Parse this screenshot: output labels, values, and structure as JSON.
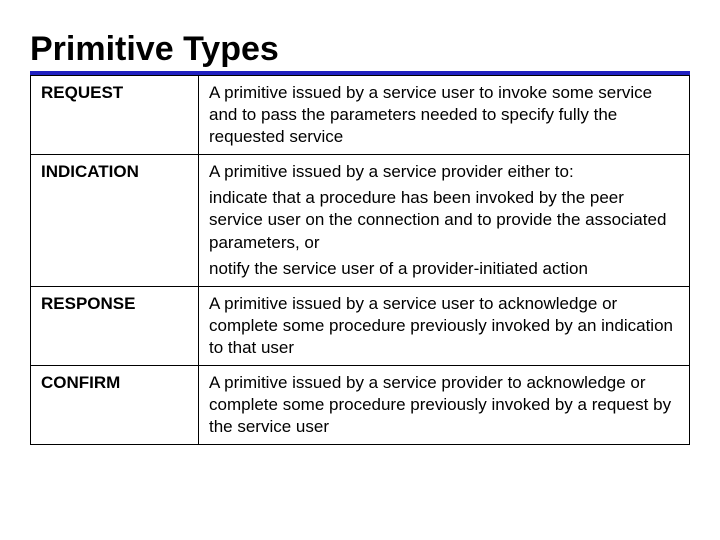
{
  "title": "Primitive Types",
  "rows": [
    {
      "name": "REQUEST",
      "desc": [
        "A primitive issued by a service user to invoke some service and to pass the parameters needed to specify fully the requested service"
      ]
    },
    {
      "name": "INDICATION",
      "desc": [
        "A primitive issued by a service provider either to:",
        "indicate that a procedure has been invoked by the peer service user on the connection and to provide the associated parameters, or",
        "notify the service user of a provider-initiated action"
      ]
    },
    {
      "name": "RESPONSE",
      "desc": [
        "A primitive issued by a service user to acknowledge or complete some procedure previously invoked by an indication to that user"
      ]
    },
    {
      "name": "CONFIRM",
      "desc": [
        "A primitive issued by a service provider to acknowledge or complete some procedure previously invoked by a request by the service user"
      ]
    }
  ]
}
